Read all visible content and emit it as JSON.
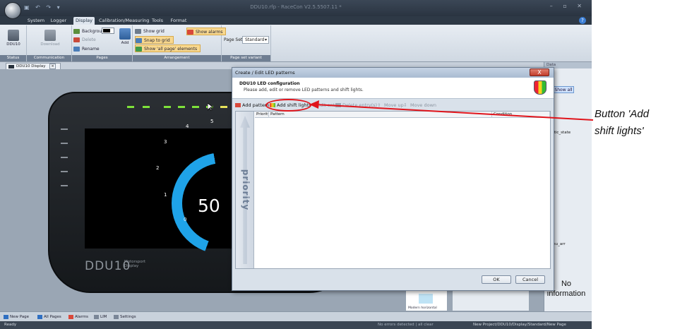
{
  "window": {
    "title": "DDU10.rfp - RaceCon V2.5.5507.11 *",
    "qat_icons": [
      "save-icon",
      "undo-icon",
      "redo-icon"
    ]
  },
  "ribbon": {
    "tabs": [
      "System",
      "Logger",
      "Display",
      "Calibration/Measuring",
      "Tools",
      "Format"
    ],
    "active_tab": "Display",
    "groups": {
      "status": {
        "label": "Status",
        "button": "DDU10"
      },
      "communication": {
        "label": "Communication",
        "button": "Download"
      },
      "pages": {
        "label": "Pages",
        "background": "Background",
        "delete": "Delete",
        "rename": "Rename",
        "add": "Add"
      },
      "arrangement": {
        "label": "Arrangement",
        "show_grid": "Show grid",
        "snap_to_grid": "Snap to grid",
        "show_all_page": "Show 'all page' elements",
        "show_alarms": "Show alarms"
      },
      "page_set": {
        "label": "Page set variant",
        "field_label": "Page Set",
        "value": "Standard"
      }
    }
  },
  "document_tab": {
    "label": "DDU10 Display"
  },
  "display": {
    "gauge_value": "50",
    "ticks": [
      "0",
      "1",
      "2",
      "3",
      "4",
      "5"
    ],
    "brand": "DDU10",
    "brand_sub_1": "Motorsport",
    "brand_sub_2": "Display"
  },
  "right_panel": {
    "title": "Data",
    "show_all": "Show all",
    "items": [
      "nostic_state",
      "Menu_arr",
      "ood"
    ],
    "no_info": "No information"
  },
  "preview": {
    "label": "Modern horizontal"
  },
  "page_tabs": [
    "New Page",
    "All Pages",
    "Alarms",
    "LIM",
    "Settings"
  ],
  "status_bar": {
    "left": "Ready",
    "middle": "No errors detected | all clear",
    "path": "New Project/DDU10/Display/Standard/New Page"
  },
  "dialog": {
    "title": "Create / Edit LED patterns",
    "close": "X",
    "header_title": "DDU10 LED configuration",
    "header_subtitle": "Please add, edit or remove LED patterns and shift lights.",
    "toolbar": {
      "add_pattern": "Add pattern",
      "add_shift_lights": "Add shift lights",
      "edit_entry": "Edit entry",
      "delete_entry": "Delete entry(s)",
      "move_up": "Move up",
      "move_down": "Move down"
    },
    "columns": [
      "Priority",
      "Pattern",
      "Condition"
    ],
    "priority_label": "priority",
    "ok": "OK",
    "cancel": "Cancel"
  },
  "callout": {
    "line1": "Button 'Add",
    "line2": "shift lights'",
    "color": "#e0141b"
  }
}
